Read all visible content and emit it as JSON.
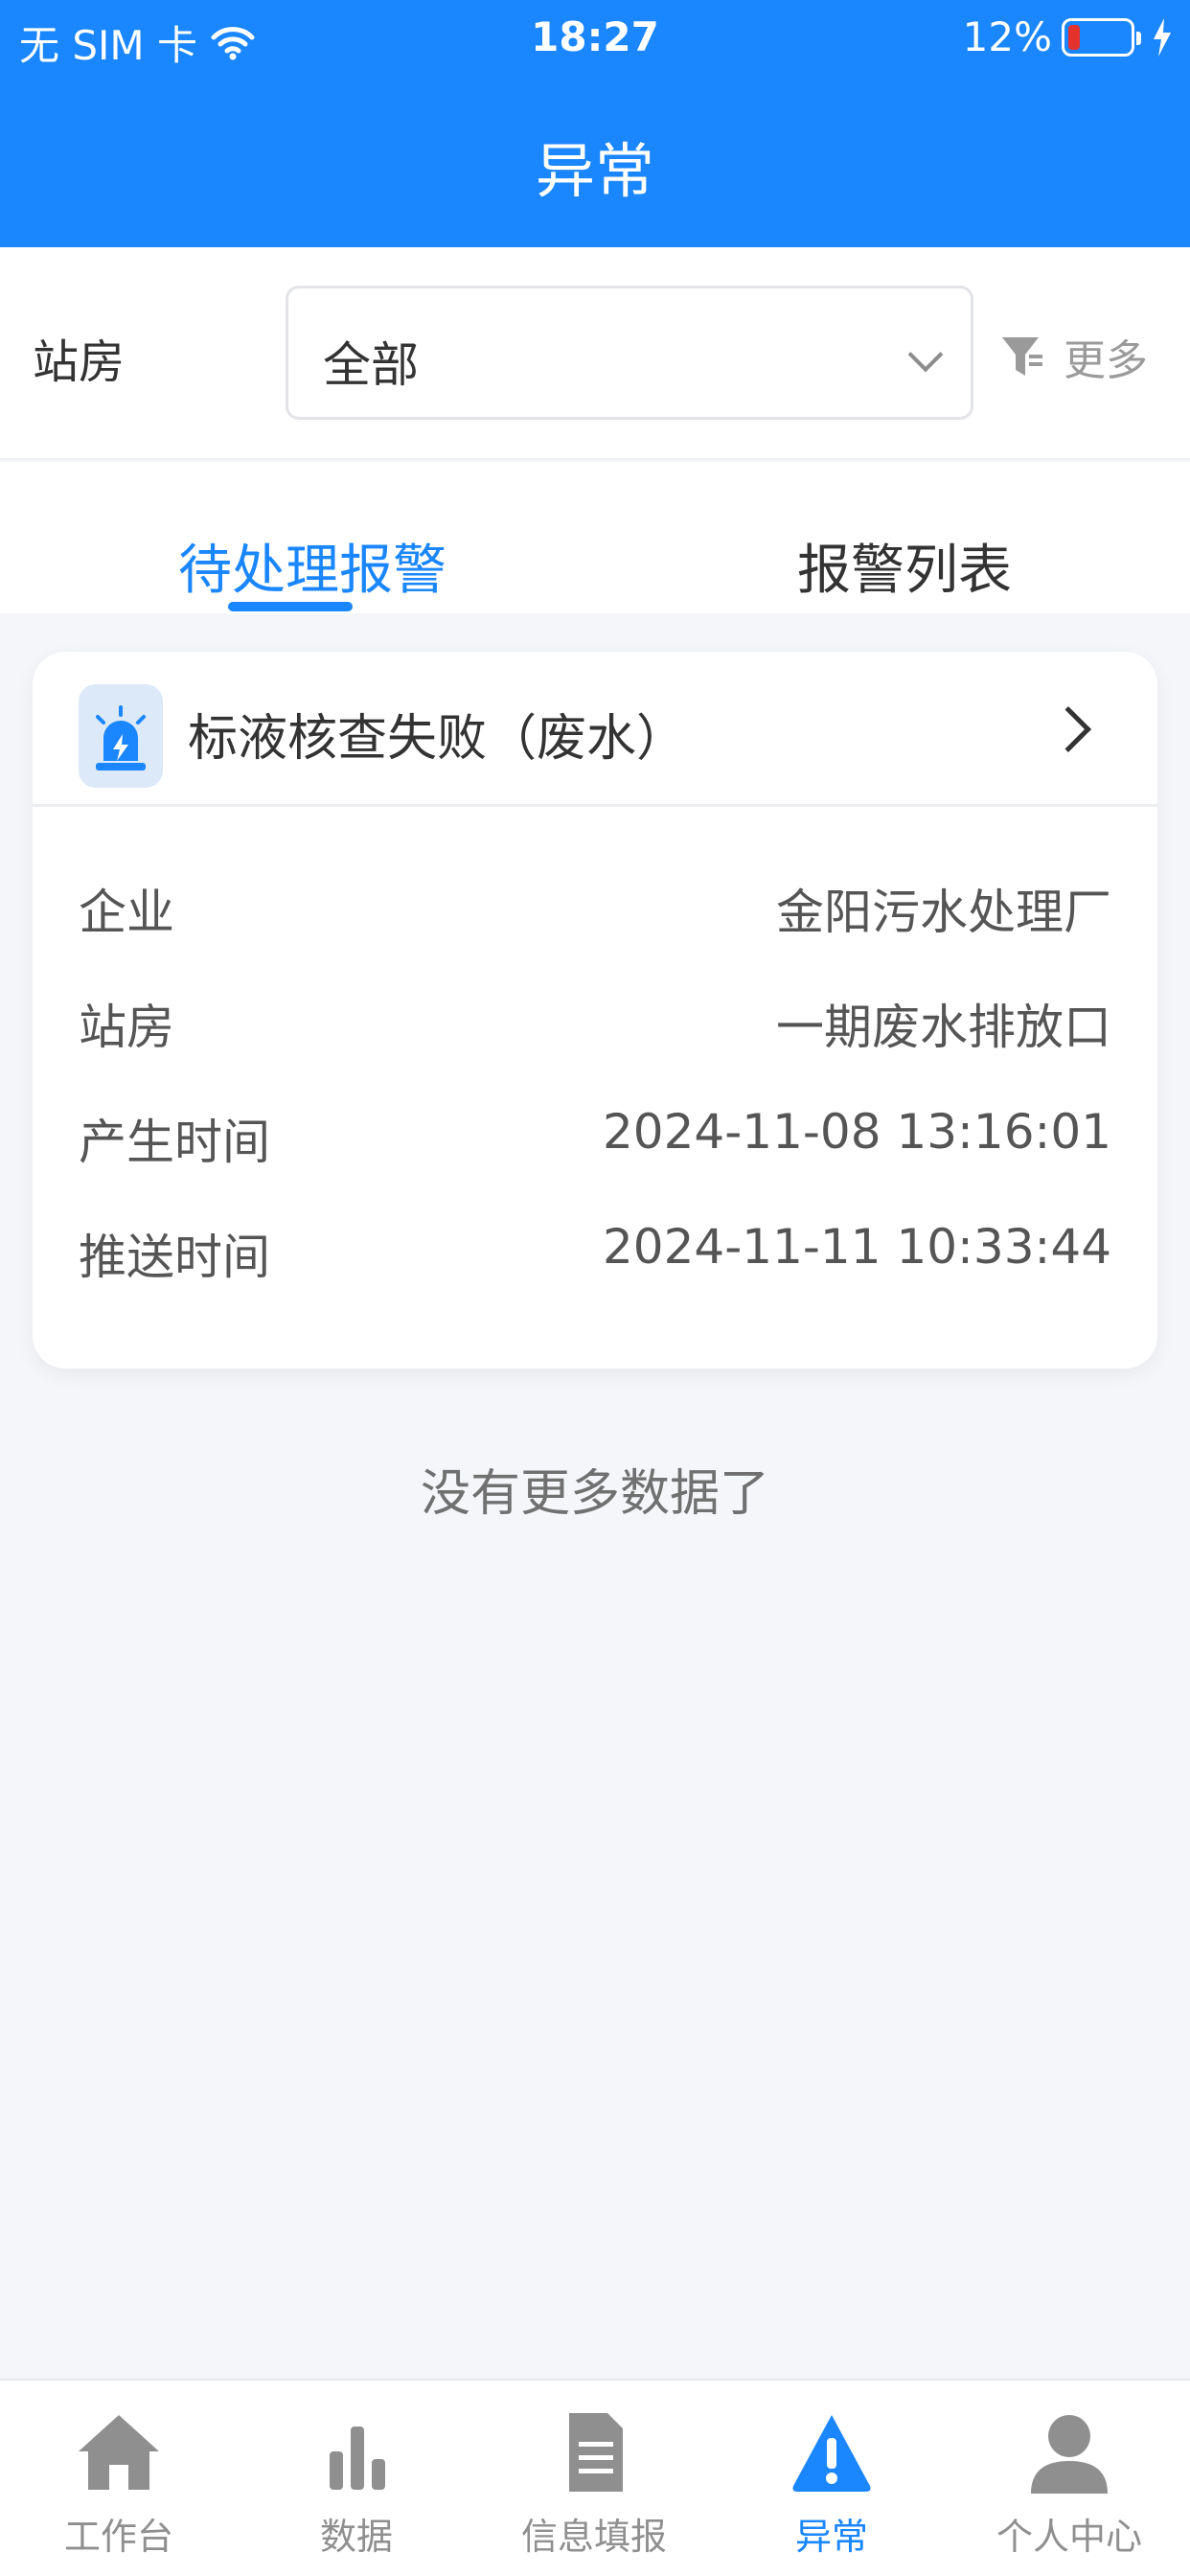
{
  "status_bar": {
    "carrier": "无 SIM 卡",
    "time": "18:27",
    "battery": "12%"
  },
  "header": {
    "title": "异常"
  },
  "filter": {
    "label": "站房",
    "select_value": "全部",
    "more_label": "更多"
  },
  "tabs": [
    {
      "label": "待处理报警",
      "active": true
    },
    {
      "label": "报警列表",
      "active": false
    }
  ],
  "alarm_card": {
    "title": "标液核查失败（废水）",
    "rows": [
      {
        "label": "企业",
        "value": "金阳污水处理厂"
      },
      {
        "label": "站房",
        "value": "一期废水排放口"
      },
      {
        "label": "产生时间",
        "value": "2024-11-08 13:16:01"
      },
      {
        "label": "推送时间",
        "value": "2024-11-11 10:33:44"
      }
    ]
  },
  "no_more_text": "没有更多数据了",
  "bottom_nav": [
    {
      "label": "工作台",
      "icon": "home-icon"
    },
    {
      "label": "数据",
      "icon": "bar-chart-icon"
    },
    {
      "label": "信息填报",
      "icon": "document-icon"
    },
    {
      "label": "异常",
      "icon": "warning-icon",
      "active": true
    },
    {
      "label": "个人中心",
      "icon": "user-icon"
    }
  ],
  "colors": {
    "primary": "#1a86ff",
    "battery_low": "#e5322d",
    "nav_inactive": "#8f8f8f"
  }
}
